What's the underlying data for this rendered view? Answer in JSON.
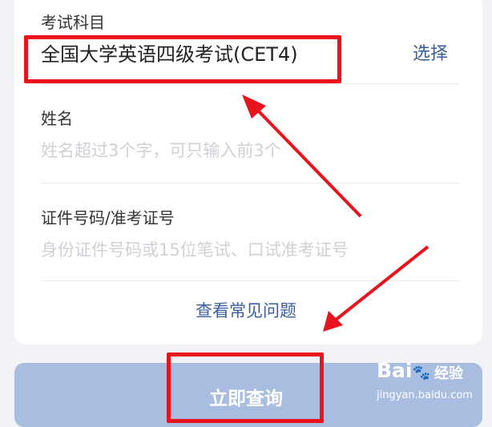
{
  "form": {
    "subject": {
      "label": "考试科目",
      "value": "全国大学英语四级考试(CET4)",
      "action": "选择"
    },
    "name": {
      "label": "姓名",
      "placeholder": "姓名超过3个字，可只输入前3个"
    },
    "id_number": {
      "label": "证件号码/准考证号",
      "placeholder": "身份证件号码或15位笔试、口试准考证号"
    },
    "faq_link": "查看常见问题"
  },
  "submit_label": "立即查询",
  "watermark": {
    "logo": "Bai",
    "paw": "🐾",
    "brand": "经验",
    "url": "jingyan.baidu.com"
  },
  "colors": {
    "annotation": "#e8131c",
    "link": "#3a5d9c",
    "button": "#a9bde0"
  }
}
